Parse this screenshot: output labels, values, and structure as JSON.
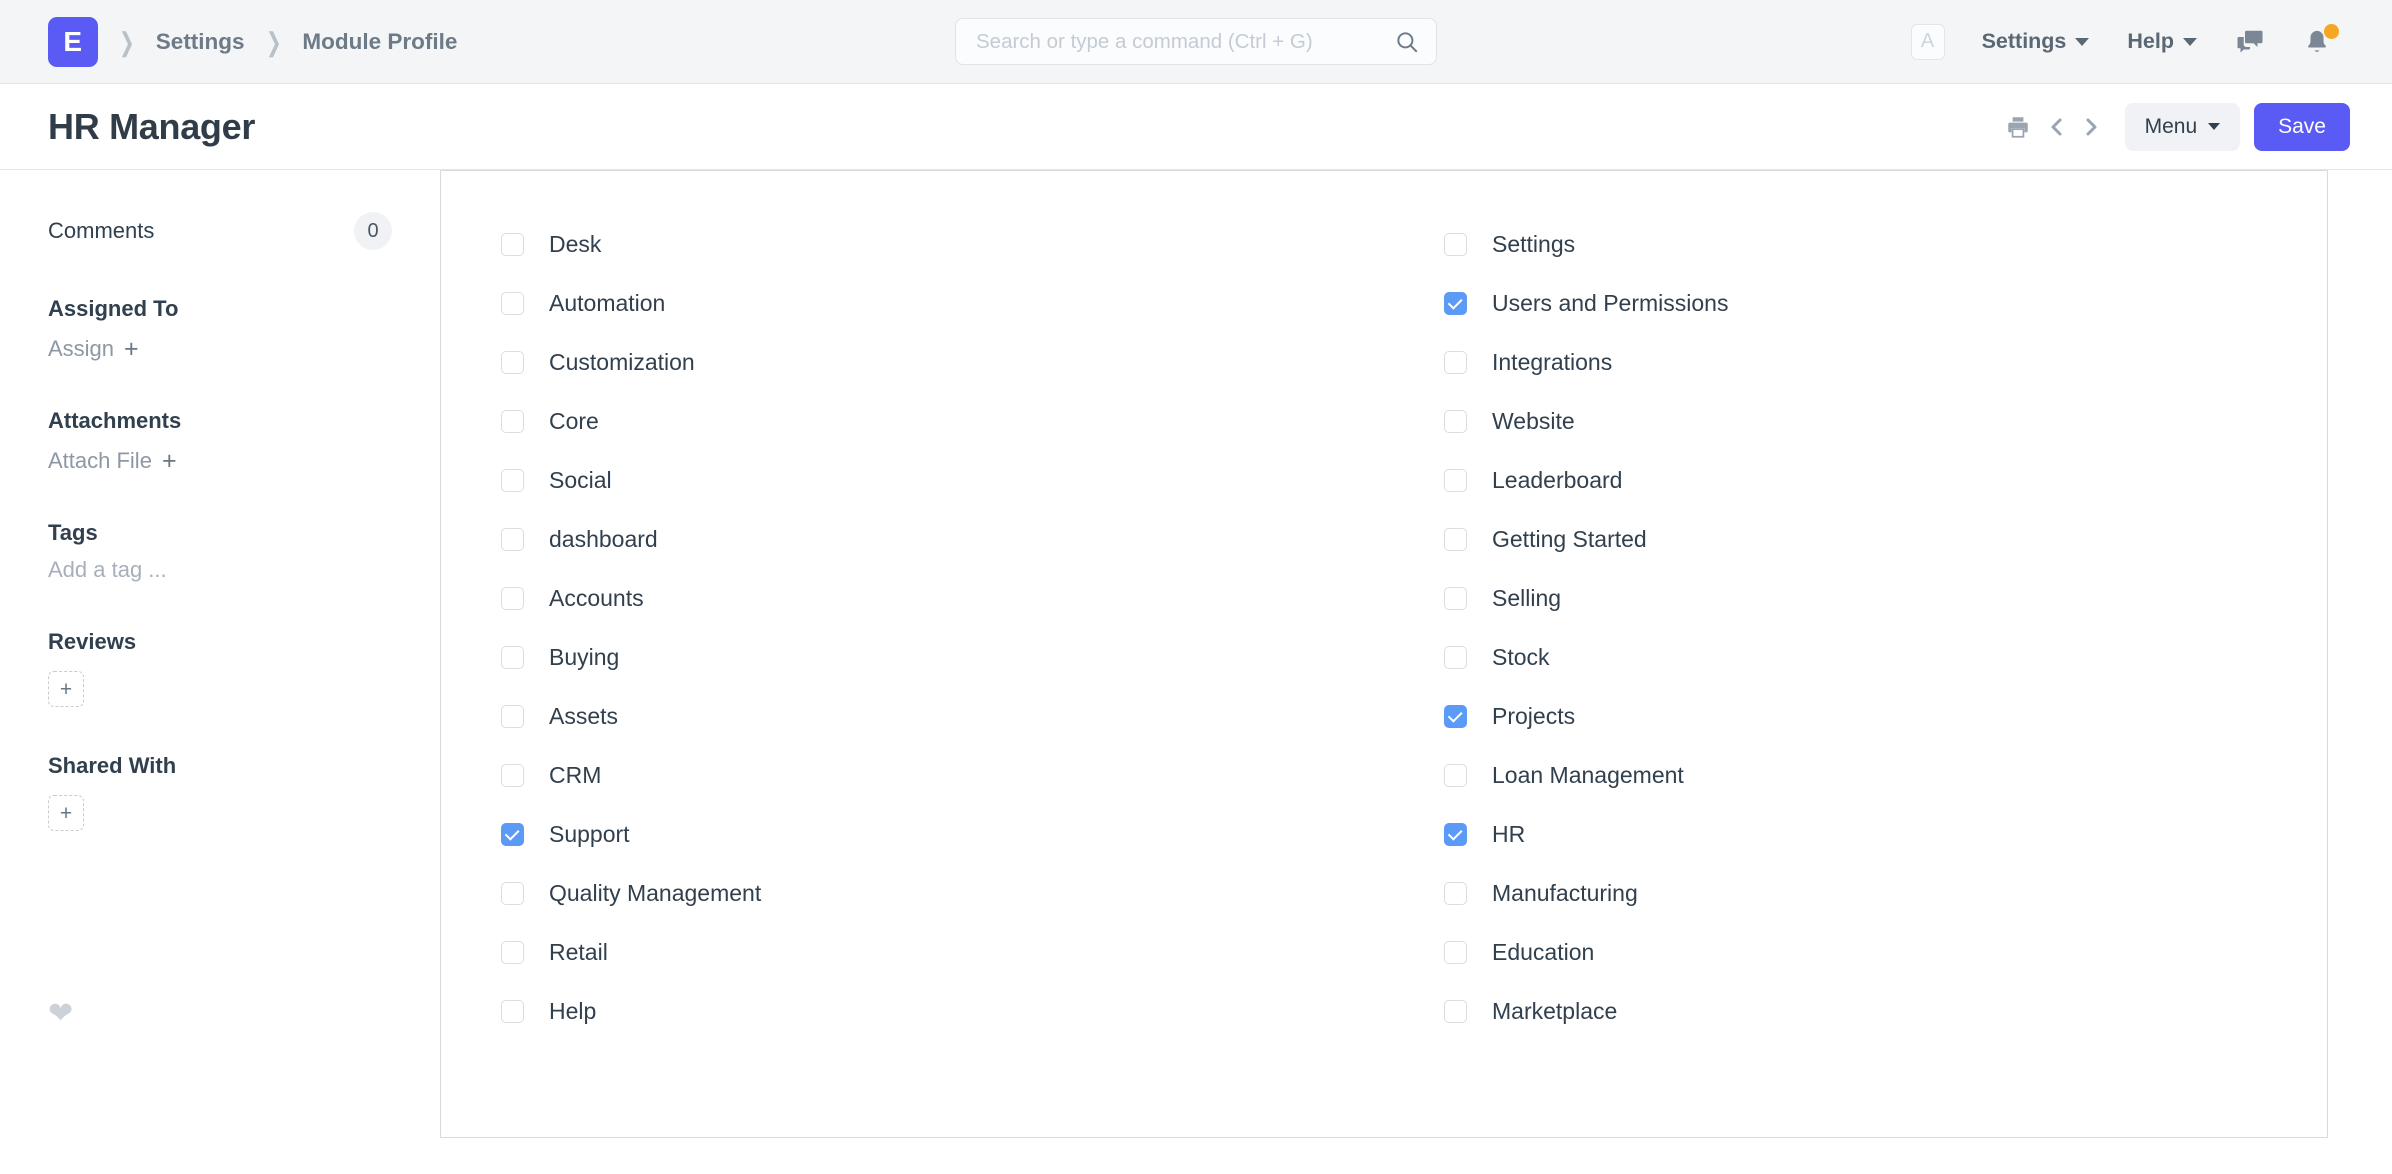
{
  "navbar": {
    "logo_letter": "E",
    "breadcrumbs": [
      {
        "label": "Settings"
      },
      {
        "label": "Module Profile"
      }
    ],
    "search": {
      "placeholder": "Search or type a command (Ctrl + G)",
      "value": ""
    },
    "avatar_letter": "A",
    "settings_label": "Settings",
    "help_label": "Help",
    "notification_badge_color": "#f5a623",
    "brand_color": "#5a5af5"
  },
  "page_head": {
    "title": "HR Manager",
    "menu_label": "Menu",
    "save_label": "Save"
  },
  "sidebar": {
    "comments_label": "Comments",
    "comments_count": "0",
    "assigned_to_label": "Assigned To",
    "assign_action": "Assign",
    "attachments_label": "Attachments",
    "attach_action": "Attach File",
    "tags_label": "Tags",
    "tags_placeholder": "Add a tag ...",
    "reviews_label": "Reviews",
    "reviews_add": "+",
    "shared_with_label": "Shared With",
    "shared_with_add": "+",
    "plus": "+"
  },
  "modules": {
    "left_column": [
      {
        "label": "Desk",
        "checked": false
      },
      {
        "label": "Automation",
        "checked": false
      },
      {
        "label": "Customization",
        "checked": false
      },
      {
        "label": "Core",
        "checked": false
      },
      {
        "label": "Social",
        "checked": false
      },
      {
        "label": "dashboard",
        "checked": false
      },
      {
        "label": "Accounts",
        "checked": false
      },
      {
        "label": "Buying",
        "checked": false
      },
      {
        "label": "Assets",
        "checked": false
      },
      {
        "label": "CRM",
        "checked": false
      },
      {
        "label": "Support",
        "checked": true
      },
      {
        "label": "Quality Management",
        "checked": false
      },
      {
        "label": "Retail",
        "checked": false
      },
      {
        "label": "Help",
        "checked": false
      }
    ],
    "right_column": [
      {
        "label": "Settings",
        "checked": false
      },
      {
        "label": "Users and Permissions",
        "checked": true
      },
      {
        "label": "Integrations",
        "checked": false
      },
      {
        "label": "Website",
        "checked": false
      },
      {
        "label": "Leaderboard",
        "checked": false
      },
      {
        "label": "Getting Started",
        "checked": false
      },
      {
        "label": "Selling",
        "checked": false
      },
      {
        "label": "Stock",
        "checked": false
      },
      {
        "label": "Projects",
        "checked": true
      },
      {
        "label": "Loan Management",
        "checked": false
      },
      {
        "label": "HR",
        "checked": true
      },
      {
        "label": "Manufacturing",
        "checked": false
      },
      {
        "label": "Education",
        "checked": false
      },
      {
        "label": "Marketplace",
        "checked": false
      }
    ],
    "checked_color": "#5b9af6"
  }
}
